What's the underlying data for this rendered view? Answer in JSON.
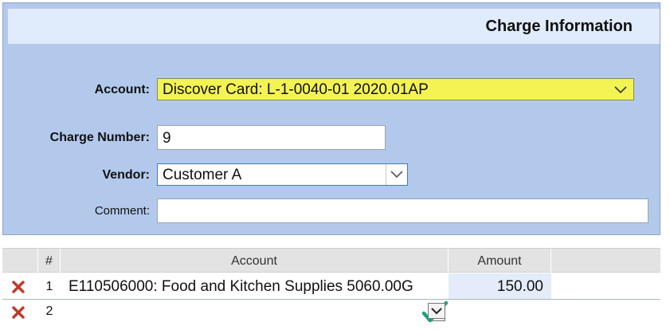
{
  "panel": {
    "title": "Charge Information",
    "account": {
      "label": "Account:",
      "value": "Discover Card: L-1-0040-01 2020.01AP"
    },
    "charge_number": {
      "label": "Charge Number:",
      "value": "9"
    },
    "vendor": {
      "label": "Vendor:",
      "value": "Customer A"
    },
    "comment": {
      "label": "Comment:",
      "value": ""
    }
  },
  "grid": {
    "columns": [
      "#",
      "Account",
      "Amount"
    ],
    "rows": [
      {
        "number": "1",
        "account": "E110506000: Food and Kitchen Supplies 5060.00G",
        "amount": "150.00"
      },
      {
        "number": "2",
        "account": "",
        "amount": ""
      }
    ]
  },
  "colors": {
    "panel_bg": "#b3c9ec",
    "header_bg": "#e0ebfb",
    "highlight": "#f3f353",
    "delete_red": "#c0392b",
    "check_green": "#1aa37a"
  }
}
